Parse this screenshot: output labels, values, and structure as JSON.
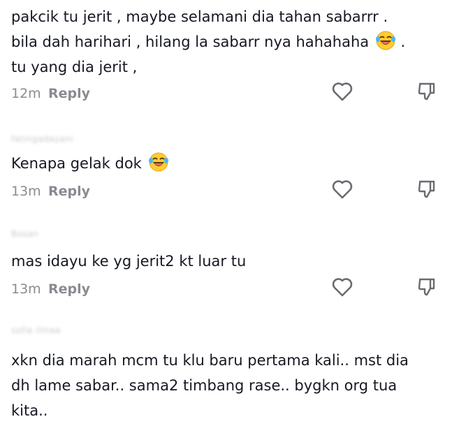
{
  "comments": [
    {
      "username": "",
      "text_before": "pakcik tu jerit , maybe selamani dia tahan sabarrr .\nbila dah harihari , hilang la sabarr nya hahahaha ",
      "text_after": " .\ntu yang dia jerit ,",
      "time": "12m",
      "reply": "Reply"
    },
    {
      "username": "fatingadayani",
      "text_before": "Kenapa gelak dok ",
      "text_after": "",
      "time": "13m",
      "reply": "Reply"
    },
    {
      "username": "Bosan",
      "text_before": "mas idayu ke yg jerit2 kt luar tu",
      "text_after": "",
      "time": "13m",
      "reply": "Reply"
    },
    {
      "username": "sofia ilmaa",
      "text_before": "xkn dia marah mcm tu klu baru pertama kali.. mst dia\ndh lame sabar.. sama2 timbang rase.. bygkn org tua\nkita..",
      "text_after": "",
      "time": "",
      "reply": ""
    }
  ],
  "icons": {
    "like": "heart-outline-icon",
    "dislike": "thumbs-down-icon",
    "emoji": "laughing-tears-emoji"
  },
  "colors": {
    "text": "#161823",
    "meta": "#8a8b91",
    "emoji_face": "#ffcc33"
  }
}
